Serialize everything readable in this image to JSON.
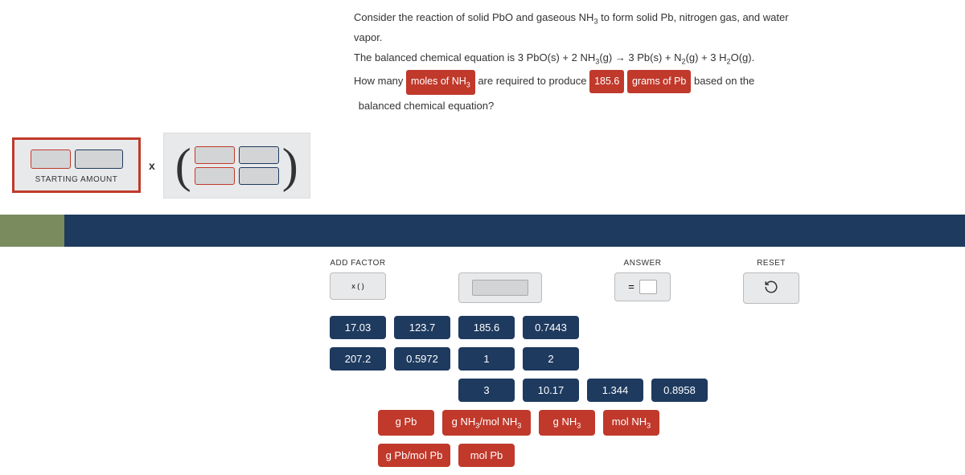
{
  "prompt": {
    "line1a": "Consider the reaction of solid PbO and gaseous NH",
    "line1b": " to form solid Pb, nitrogen gas, and water vapor.",
    "line2a": "The balanced chemical equation is 3 PbO(s) + 2 NH",
    "line2b": "(g)  →  3 Pb(s) + N",
    "line2c": "(g) + 3 H",
    "line2d": "O(g).",
    "line3a": "How many ",
    "chip1a": "moles of NH",
    "line3b": " are required to produce ",
    "chip2": "185.6",
    "chip3": "grams of Pb",
    "line3c": " based on the",
    "line4": "balanced chemical equation?"
  },
  "workspace": {
    "starting_label": "STARTING AMOUNT",
    "times": "x"
  },
  "controls": {
    "add_factor_label": "ADD FACTOR",
    "add_factor_symbol": "x (   )",
    "answer_label": "ANSWER",
    "answer_symbol": "=",
    "reset_label": "RESET",
    "reset_symbol": "↺"
  },
  "numeric_tiles_row1": [
    "17.03",
    "123.7",
    "185.6",
    "0.7443",
    "207.2",
    "0.5972",
    "1",
    "2"
  ],
  "numeric_tiles_row2": [
    "3",
    "10.17",
    "1.344",
    "0.8958"
  ],
  "unit_tiles": [
    {
      "label_pre": "g Pb"
    },
    {
      "label_pre": "g NH",
      "sub": "3",
      "label_post": "/mol NH",
      "sub2": "3"
    },
    {
      "label_pre": "g NH",
      "sub": "3"
    },
    {
      "label_pre": "mol NH",
      "sub": "3"
    },
    {
      "label_pre": "g Pb/mol Pb"
    },
    {
      "label_pre": "mol Pb"
    }
  ]
}
